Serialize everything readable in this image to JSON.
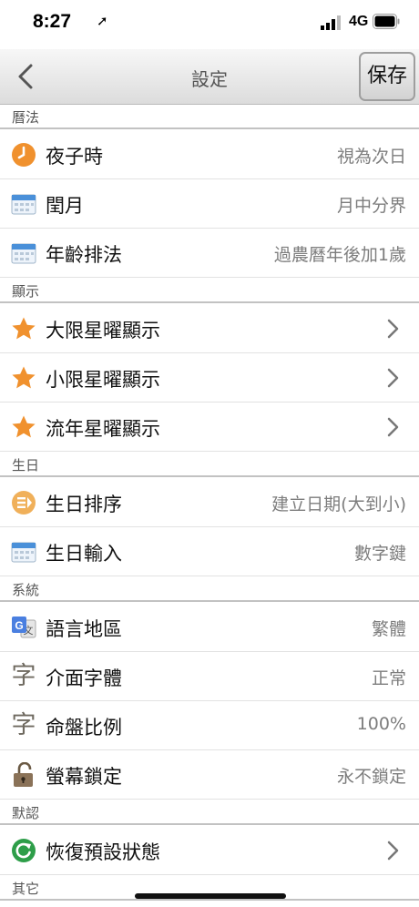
{
  "status_bar": {
    "time": "8:27",
    "network": "4G"
  },
  "nav": {
    "title": "設定",
    "save_label": "保存"
  },
  "sections": {
    "calendar": {
      "header": "曆法",
      "rows": [
        {
          "label": "夜子時",
          "value": "視為次日",
          "icon": "clock-icon"
        },
        {
          "label": "閏月",
          "value": "月中分界",
          "icon": "calendar-icon"
        },
        {
          "label": "年齡排法",
          "value": "過農曆年後加1歲",
          "icon": "calendar-icon"
        }
      ]
    },
    "display": {
      "header": "顯示",
      "rows": [
        {
          "label": "大限星曜顯示",
          "icon": "star-icon"
        },
        {
          "label": "小限星曜顯示",
          "icon": "star-icon"
        },
        {
          "label": "流年星曜顯示",
          "icon": "star-icon"
        }
      ]
    },
    "birthday": {
      "header": "生日",
      "rows": [
        {
          "label": "生日排序",
          "value": "建立日期(大到小)",
          "icon": "sort-icon"
        },
        {
          "label": "生日輸入",
          "value": "數字鍵",
          "icon": "calendar-icon"
        }
      ]
    },
    "system": {
      "header": "系統",
      "rows": [
        {
          "label": "語言地區",
          "value": "繁體",
          "icon": "translate-icon"
        },
        {
          "label": "介面字體",
          "value": "正常",
          "icon": "font-icon",
          "glyph": "字"
        },
        {
          "label": "命盤比例",
          "value": "100%",
          "icon": "font-icon",
          "glyph": "字"
        },
        {
          "label": "螢幕鎖定",
          "value": "永不鎖定",
          "icon": "unlock-icon"
        }
      ]
    },
    "defaults": {
      "header": "默認",
      "rows": [
        {
          "label": "恢復預設狀態",
          "icon": "reset-icon"
        }
      ]
    },
    "other": {
      "header": "其它"
    }
  },
  "colors": {
    "orange": "#f0912e",
    "calendar_blue": "#4a90d9",
    "green": "#2e9e49",
    "section_text": "#555555",
    "value_text": "#7d7d7d"
  }
}
